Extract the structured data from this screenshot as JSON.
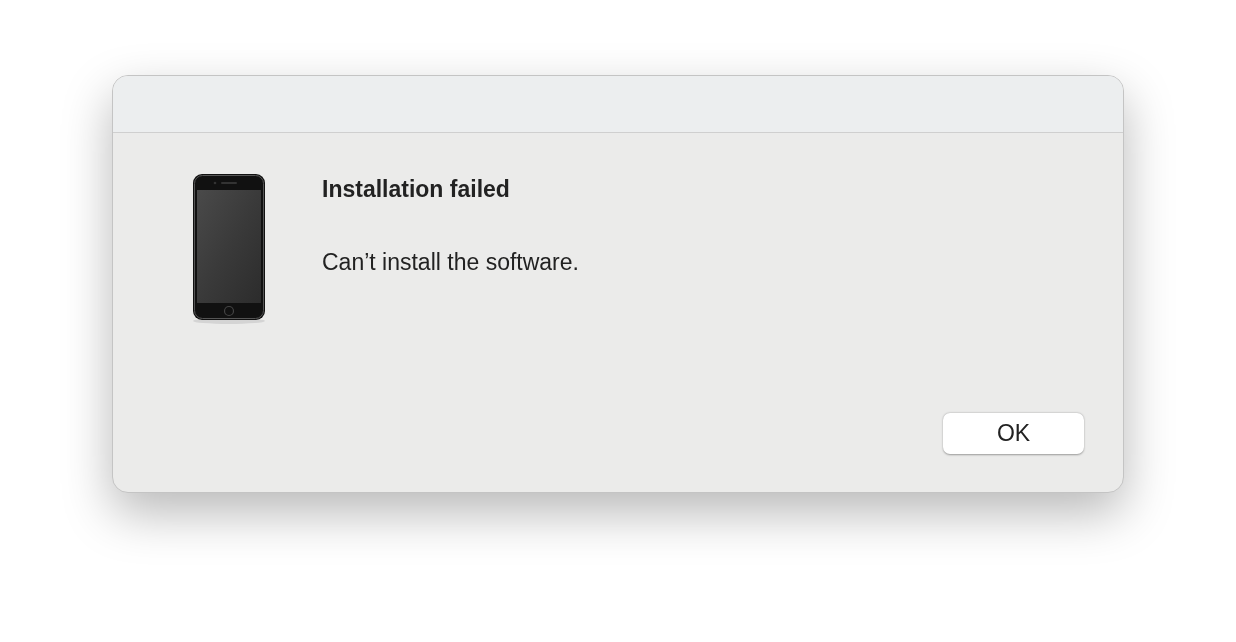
{
  "dialog": {
    "title": "Installation failed",
    "message": "Can’t install the software.",
    "buttons": [
      "OK"
    ]
  }
}
